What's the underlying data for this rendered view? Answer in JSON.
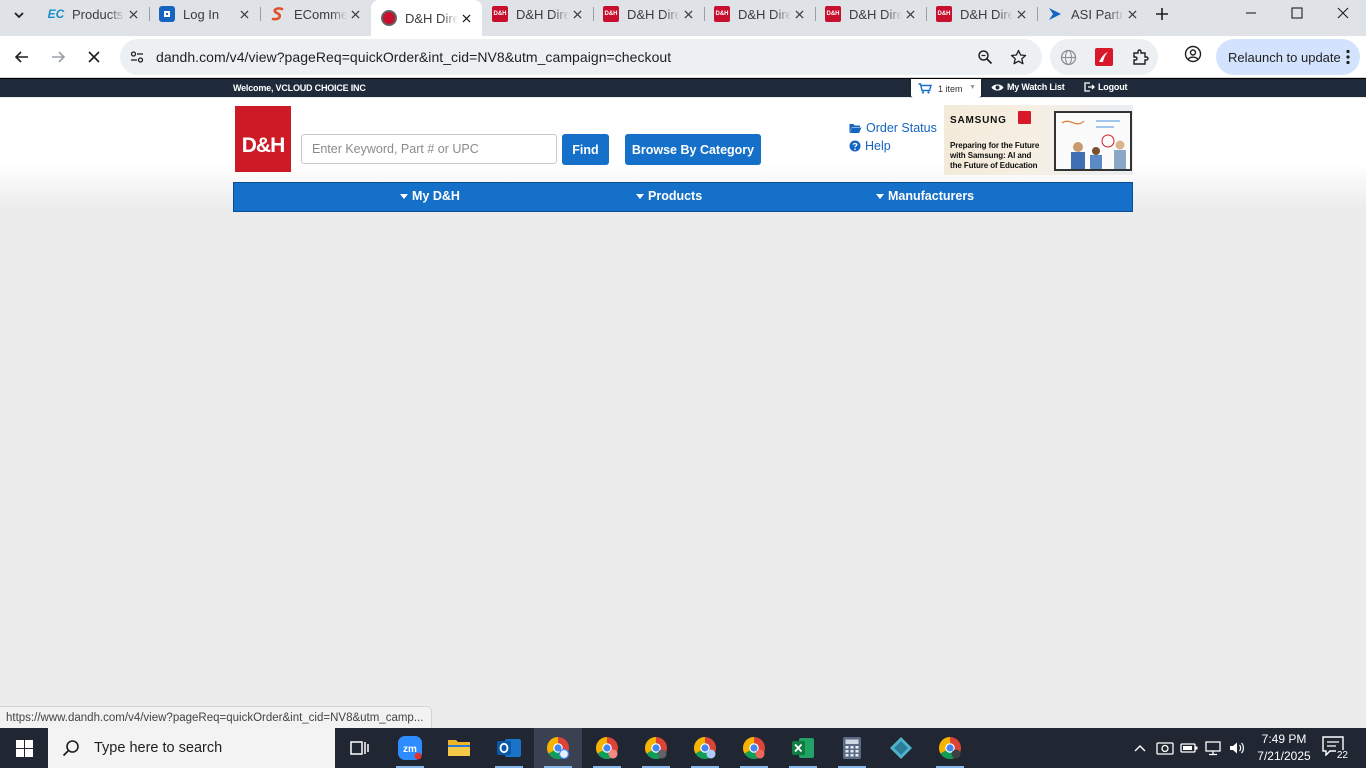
{
  "browser": {
    "tabs": [
      {
        "label": "Products",
        "favicon": "ecommerce-favicon"
      },
      {
        "label": "Log In",
        "favicon": "login-favicon"
      },
      {
        "label": "ECommerce",
        "favicon": "ecommerce-s-favicon"
      },
      {
        "label": "D&H Direct",
        "favicon": "dh-favicon",
        "active": true
      },
      {
        "label": "D&H Direct",
        "favicon": "dh-favicon"
      },
      {
        "label": "D&H Direct",
        "favicon": "dh-favicon"
      },
      {
        "label": "D&H Direct",
        "favicon": "dh-favicon"
      },
      {
        "label": "D&H Direct",
        "favicon": "dh-favicon"
      },
      {
        "label": "D&H Direct",
        "favicon": "dh-favicon"
      },
      {
        "label": "ASI Partner",
        "favicon": "asi-favicon"
      }
    ],
    "url": "dandh.com/v4/view?pageReq=quickOrder&int_cid=NV8&utm_campaign=checkout",
    "relaunch_label": "Relaunch to update",
    "status_url": "https://www.dandh.com/v4/view?pageReq=quickOrder&int_cid=NV8&utm_camp..."
  },
  "page": {
    "welcome": "Welcome, VCLOUD CHOICE INC",
    "cart_label": "1 item",
    "watchlist_label": "My Watch List",
    "logout_label": "Logout",
    "logo_text": "D&H",
    "search": {
      "placeholder": "Enter Keyword, Part # or UPC",
      "value": ""
    },
    "find_label": "Find",
    "browse_label": "Browse By Category",
    "order_status_label": "Order Status",
    "help_label": "Help",
    "banner": {
      "brand": "SAMSUNG",
      "line1": "Preparing for the Future",
      "line2": "with Samsung: AI and",
      "line3": "the Future of Education"
    },
    "nav": [
      "My D&H",
      "Products",
      "Manufacturers"
    ]
  },
  "taskbar": {
    "search_placeholder": "Type here to search",
    "time": "7:49 PM",
    "date": "7/21/2025",
    "notification_count": "22"
  },
  "colors": {
    "brand_red": "#cc1b26",
    "brand_blue": "#1470c8",
    "topbar": "#1f2a3b"
  }
}
